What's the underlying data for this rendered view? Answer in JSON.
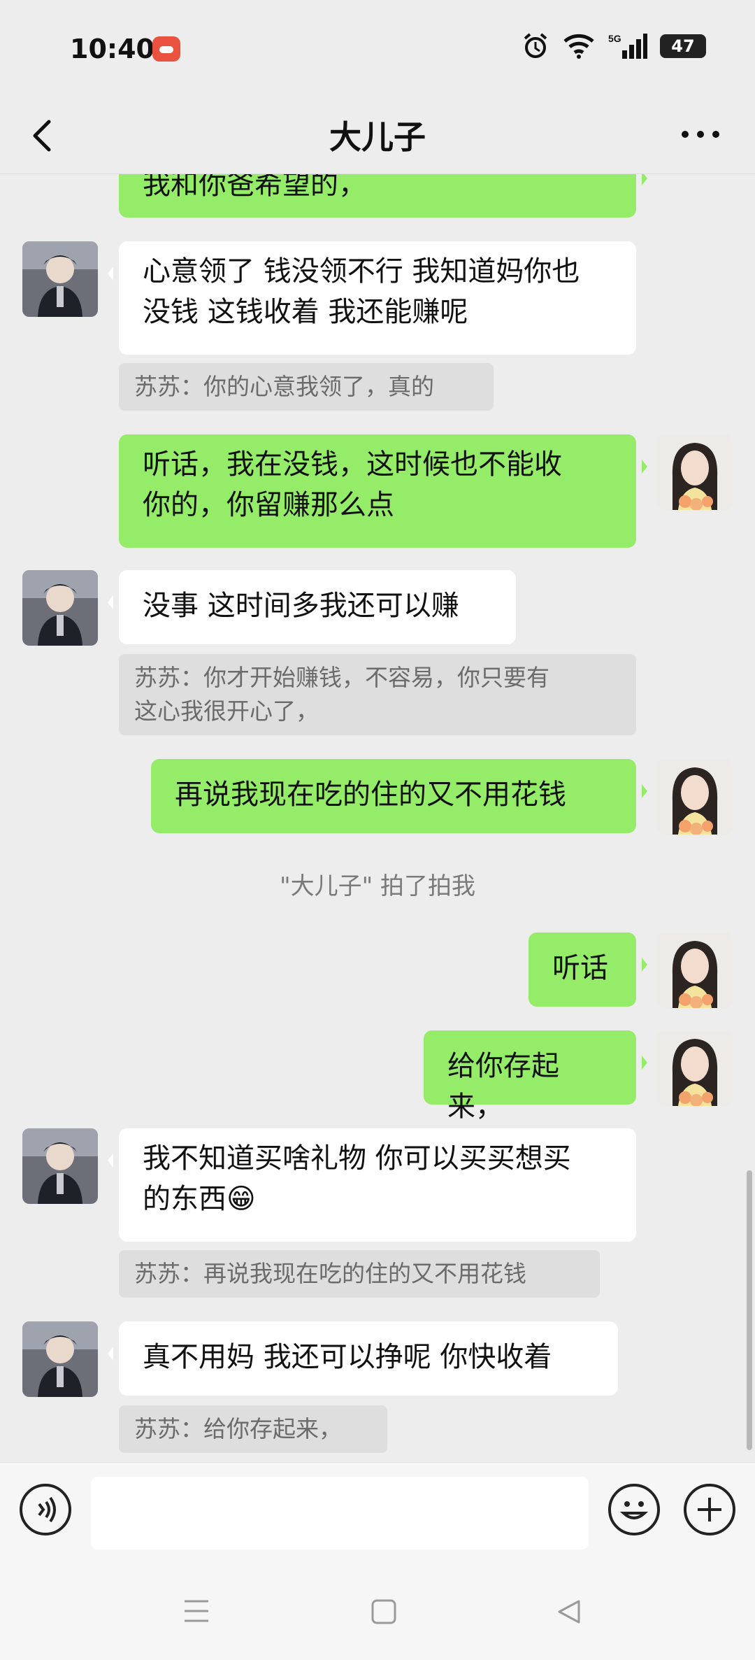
{
  "status": {
    "time": "10:40",
    "battery": "47",
    "network": "5G"
  },
  "header": {
    "title": "大儿子"
  },
  "messages": {
    "m0": {
      "text": "我和你爸希望的，"
    },
    "m1": {
      "text_line1": "心意领了 钱没领不行 我知道妈你也",
      "text_line2": "没钱 这钱收着 我还能赚呢",
      "quote": "苏苏：你的心意我领了，真的"
    },
    "m2": {
      "text_line1": "听话，我在没钱，这时候也不能收",
      "text_line2": "你的，你留赚那么点"
    },
    "m3": {
      "text": "没事 这时间多我还可以赚",
      "quote_line1": "苏苏：你才开始赚钱，不容易，你只要有",
      "quote_line2": "这心我很开心了，"
    },
    "m4": {
      "text": "再说我现在吃的住的又不用花钱"
    },
    "system": "\"大儿子\" 拍了拍我",
    "m5": {
      "text": "听话"
    },
    "m6": {
      "text": "给你存起来，"
    },
    "m7": {
      "text_line1": "我不知道买啥礼物 你可以买买想买",
      "text_line2": "的东西",
      "emoji": "😁",
      "quote": "苏苏：再说我现在吃的住的又不用花钱"
    },
    "m8": {
      "text": "真不用妈 我还可以挣呢 你快收着",
      "quote": "苏苏：给你存起来，"
    }
  },
  "icons": {
    "back": "chevron-left-icon",
    "more": "more-dots-icon",
    "voice": "voice-icon",
    "emoji": "emoji-icon",
    "add": "plus-icon"
  },
  "colors": {
    "outgoing_bubble": "#95ec69",
    "incoming_bubble": "#ffffff",
    "background": "#ededed"
  }
}
